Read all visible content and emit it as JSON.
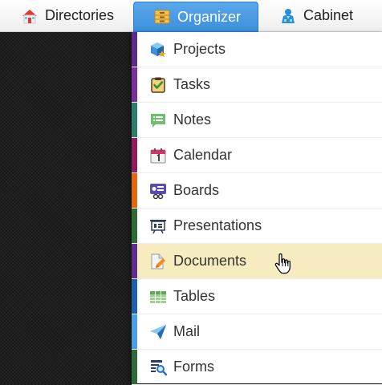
{
  "nav": {
    "tabs": [
      {
        "label": "Directories",
        "icon": "house-icon"
      },
      {
        "label": "Organizer",
        "icon": "drawer-icon",
        "active": true
      },
      {
        "label": "Cabinet",
        "icon": "user-robe-icon"
      }
    ]
  },
  "menu": {
    "items": [
      {
        "label": "Projects",
        "icon": "cube-star-icon",
        "accent": "#5b2a8c"
      },
      {
        "label": "Tasks",
        "icon": "checklist-icon",
        "accent": "#7b2f9e"
      },
      {
        "label": "Notes",
        "icon": "note-icon",
        "accent": "#2f7d6d"
      },
      {
        "label": "Calendar",
        "icon": "calendar-icon",
        "accent": "#8e1f5e"
      },
      {
        "label": "Boards",
        "icon": "board-icon",
        "accent": "#e4660f"
      },
      {
        "label": "Presentations",
        "icon": "presentation-icon",
        "accent": "#2e6b36"
      },
      {
        "label": "Documents",
        "icon": "document-pencil-icon",
        "accent": "#5d2e8c",
        "active": true
      },
      {
        "label": "Tables",
        "icon": "table-icon",
        "accent": "#1f5fae"
      },
      {
        "label": "Mail",
        "icon": "paper-plane-icon",
        "accent": "#4aa0e6"
      },
      {
        "label": "Forms",
        "icon": "form-search-icon",
        "accent": "#2f6b3a"
      }
    ]
  },
  "colors": {
    "organizer_tab": "#4a9ae4",
    "active_row": "#f6ecc0",
    "background": "#1e1e1f"
  }
}
